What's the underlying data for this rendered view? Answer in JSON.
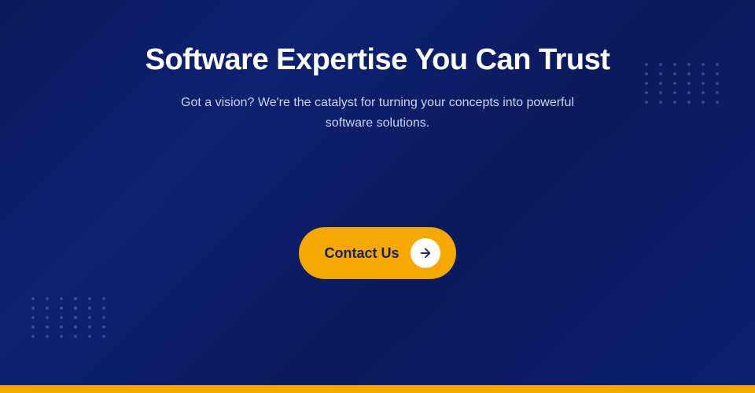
{
  "hero": {
    "title": "Software Expertise You Can Trust",
    "subtitle": "Got a vision? We're the catalyst for turning your concepts into powerful software solutions.",
    "cta_label": "Contact Us",
    "colors": {
      "background_start": "#0a1a5c",
      "background_end": "#0d2170",
      "gold": "#f5a800",
      "text_white": "#ffffff",
      "text_light": "#c8d4f0",
      "dot_color": "rgba(100,140,220,0.4)"
    }
  },
  "footer_bar": {
    "color": "#f5a800"
  },
  "icons": {
    "arrow_right": "→"
  }
}
